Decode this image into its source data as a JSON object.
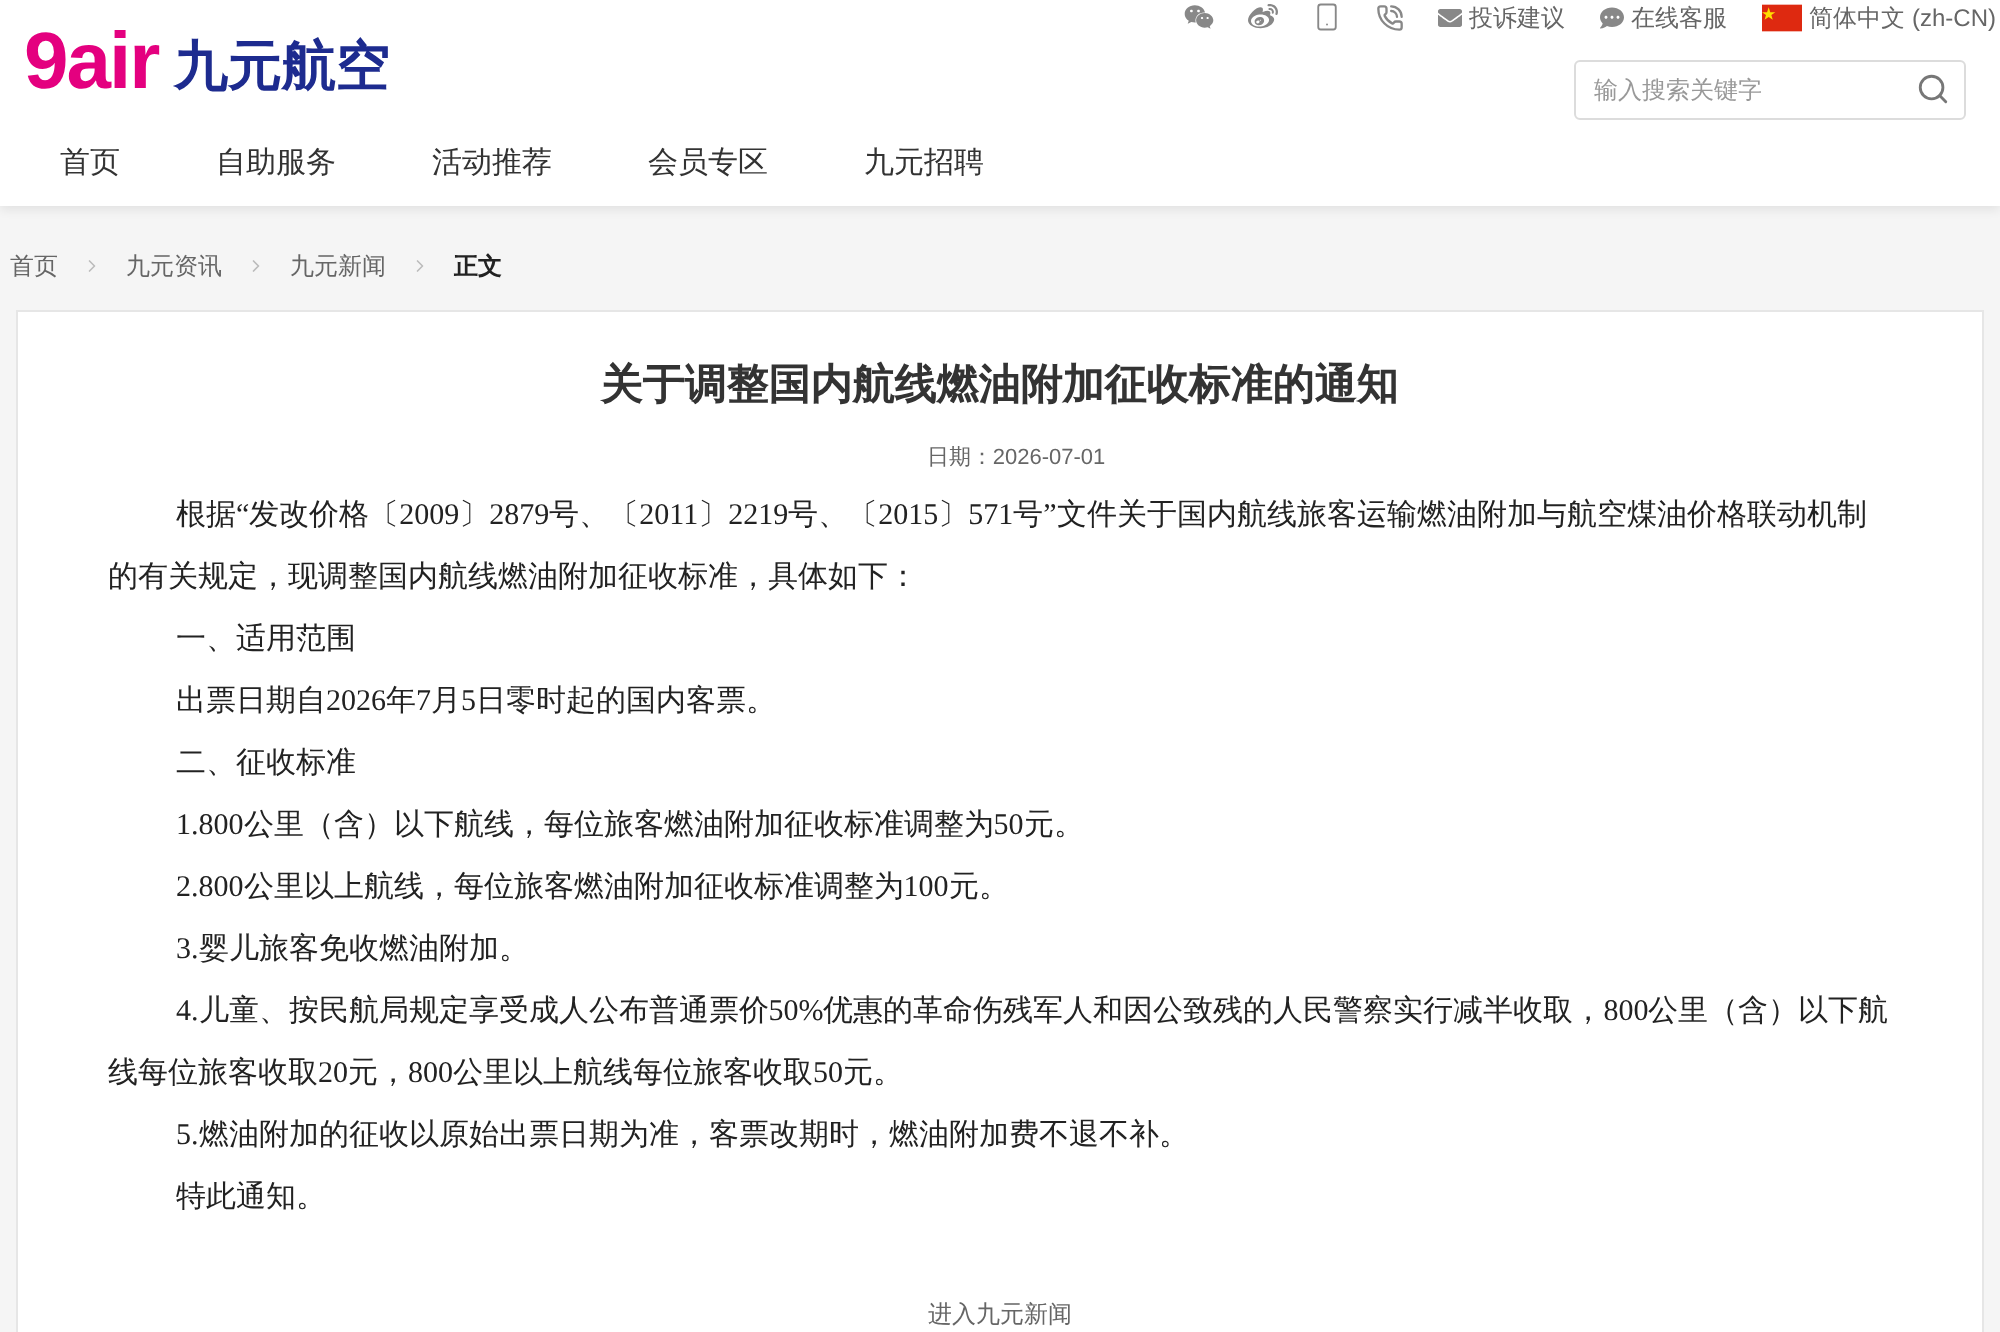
{
  "header": {
    "logo": {
      "mark": "9air",
      "name": "九元航空"
    },
    "top_links": [
      {
        "kind": "mail",
        "label": "投诉建议"
      },
      {
        "kind": "chat",
        "label": "在线客服"
      },
      {
        "kind": "language",
        "label": "简体中文 (zh-CN)"
      }
    ],
    "search": {
      "placeholder": "输入搜索关键字"
    },
    "nav": [
      "首页",
      "自助服务",
      "活动推荐",
      "会员专区",
      "九元招聘"
    ]
  },
  "breadcrumb": [
    {
      "label": "首页",
      "selected": false
    },
    {
      "label": "九元资讯",
      "selected": false
    },
    {
      "label": "九元新闻",
      "selected": false
    },
    {
      "label": "正文",
      "selected": true
    }
  ],
  "article": {
    "title": "关于调整国内航线燃油附加征收标准的通知",
    "date": "日期：2026-07-01",
    "paragraphs": [
      "根据“发改价格〔2009〕2879号、〔2011〕2219号、〔2015〕571号”文件关于国内航线旅客运输燃油附加与航空煤油价格联动机制的有关规定，现调整国内航线燃油附加征收标准，具体如下：",
      "一、适用范围",
      "出票日期自2026年7月5日零时起的国内客票。",
      "二、征收标准",
      "1.800公里（含）以下航线，每位旅客燃油附加征收标准调整为50元。",
      "2.800公里以上航线，每位旅客燃油附加征收标准调整为100元。",
      "3.婴儿旅客免收燃油附加。",
      "4.儿童、按民航局规定享受成人公布普通票价50%优惠的革命伤残军人和因公致残的人民警察实行减半收取，800公里（含）以下航线每位旅客收取20元，800公里以上航线每位旅客收取50元。",
      "5.燃油附加的征收以原始出票日期为准，客票改期时，燃油附加费不退不补。",
      "特此通知。"
    ]
  },
  "footer_link": "进入九元新闻"
}
